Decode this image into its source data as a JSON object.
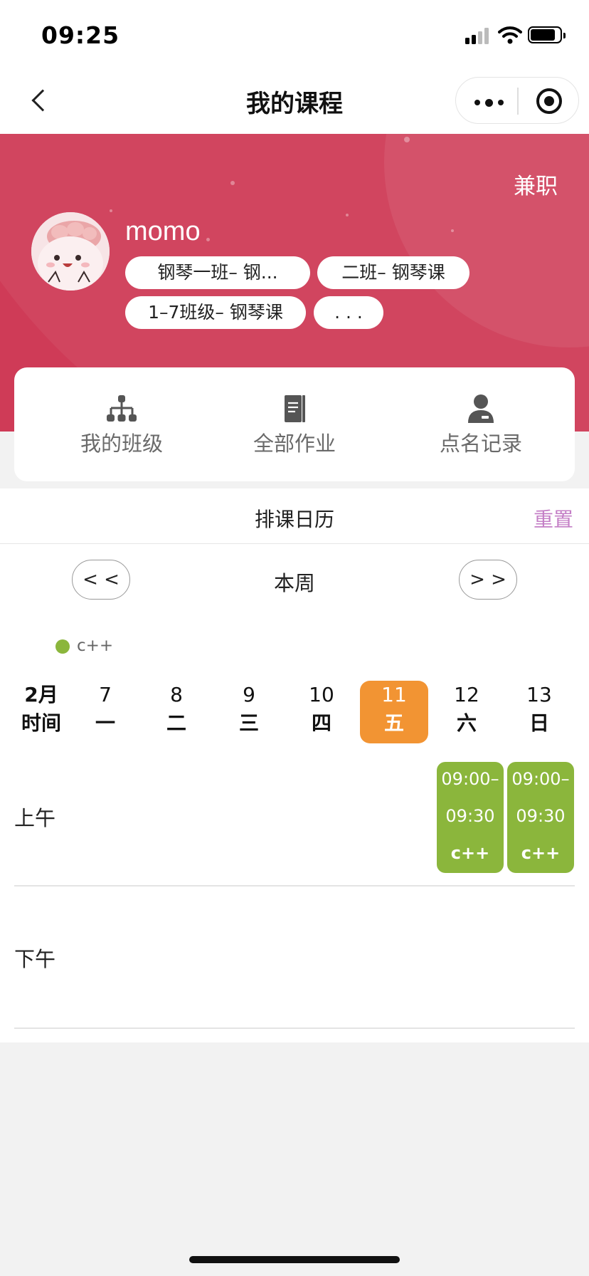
{
  "status_bar": {
    "time": "09:25"
  },
  "nav": {
    "title": "我的课程"
  },
  "profile": {
    "job_type": "兼职",
    "username": "momo",
    "class_tags": [
      "钢琴一班– 钢...",
      "二班– 钢琴课",
      "1–7班级– 钢琴课",
      ". . ."
    ]
  },
  "menu": [
    {
      "label": "我的班级",
      "icon": "org-chart-icon"
    },
    {
      "label": "全部作业",
      "icon": "notebook-icon"
    },
    {
      "label": "点名记录",
      "icon": "user-badge-icon"
    }
  ],
  "calendar": {
    "title": "排课日历",
    "reset_label": "重置",
    "prev_label": "< <",
    "next_label": "> >",
    "week_label": "本周",
    "legend": [
      {
        "name": "c++",
        "color": "#8bb63c"
      }
    ],
    "month_label": "2月",
    "time_header": "时间",
    "days": [
      {
        "num": "7",
        "weekday": "一"
      },
      {
        "num": "8",
        "weekday": "二"
      },
      {
        "num": "9",
        "weekday": "三"
      },
      {
        "num": "10",
        "weekday": "四"
      },
      {
        "num": "11",
        "weekday": "五",
        "today": true
      },
      {
        "num": "12",
        "weekday": "六"
      },
      {
        "num": "13",
        "weekday": "日"
      }
    ],
    "slots": [
      "上午",
      "下午"
    ],
    "courses": [
      {
        "day": "12",
        "slot": "上午",
        "start": "09:00–",
        "end": "09:30",
        "name": "c++"
      },
      {
        "day": "13",
        "slot": "上午",
        "start": "09:00–",
        "end": "09:30",
        "name": "c++"
      }
    ]
  },
  "colors": {
    "banner": "#cf3b57",
    "today": "#f29433",
    "course": "#8bb63c",
    "reset": "#c47fc6"
  }
}
